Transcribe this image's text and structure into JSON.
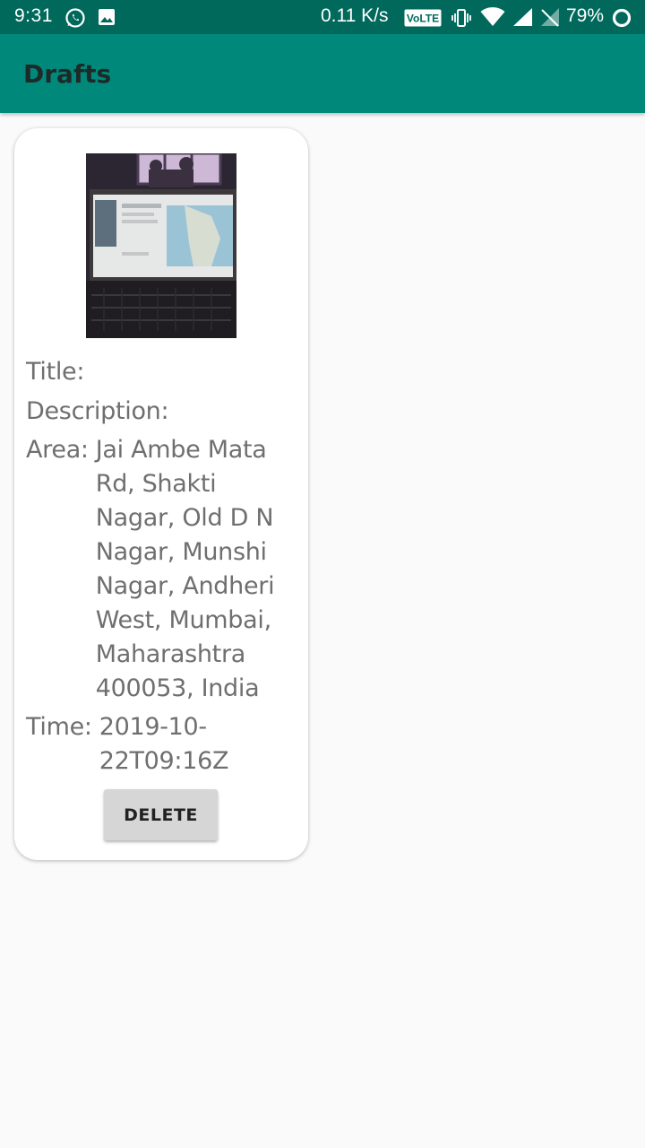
{
  "status_bar": {
    "time": "9:31",
    "network_speed": "0.11 K/s",
    "volte_label": "VoLTE",
    "battery_percent": "79%",
    "icons": [
      "whatsapp-icon",
      "image-icon",
      "volte-icon",
      "vibrate-icon",
      "wifi-icon",
      "signal-icon",
      "no-sim-icon",
      "battery-ring-icon"
    ]
  },
  "app_bar": {
    "title": "Drafts"
  },
  "draft": {
    "title_label": "Title:",
    "title_value": "",
    "description_label": "Description:",
    "description_value": "",
    "area_label": "Area:",
    "area_value": "Jai Ambe Mata Rd, Shakti Nagar, Old D N Nagar, Munshi Nagar, Andheri West, Mumbai, Maharashtra 400053, India",
    "time_label": "Time:",
    "time_value": "2019-10-22T09:16Z",
    "delete_label": "DELETE"
  },
  "colors": {
    "status_bar": "#00695c",
    "app_bar": "#00897b",
    "background": "#fafafa",
    "card": "#ffffff",
    "text_secondary": "#6f6f6f",
    "button": "#d6d6d6"
  }
}
